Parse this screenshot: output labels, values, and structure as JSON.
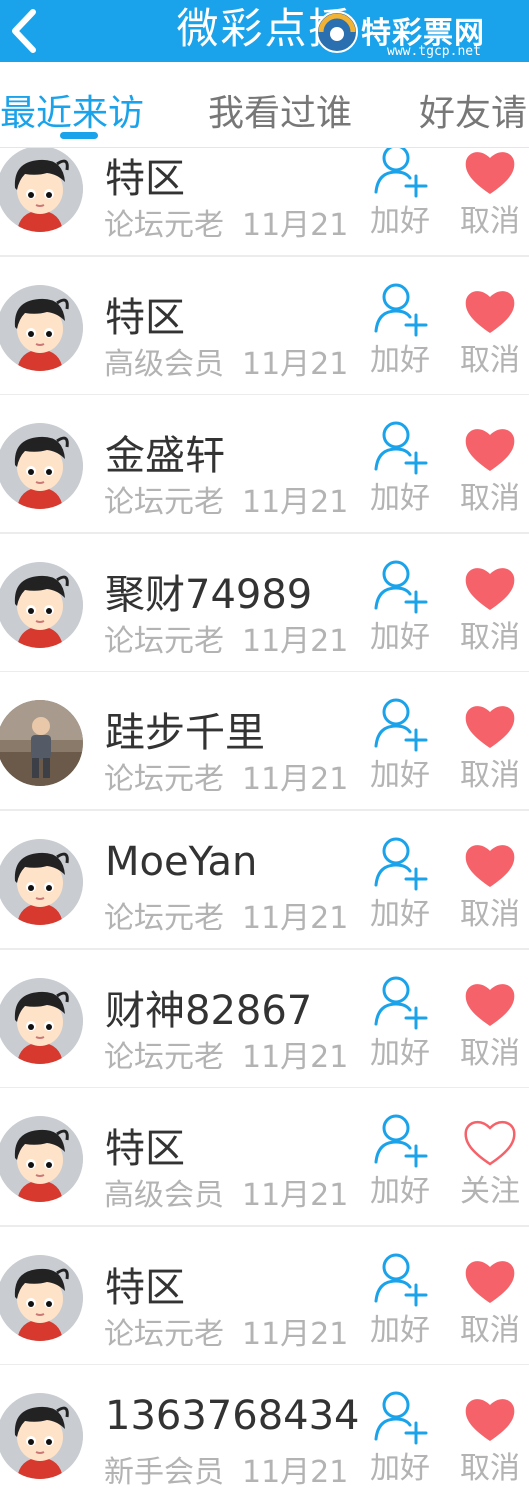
{
  "header": {
    "title": "微彩点播",
    "back_icon": "chevron-left-icon",
    "watermark": {
      "text": "特彩票网",
      "url": "www.tgcp.net"
    }
  },
  "tabs": [
    {
      "label": "最近来访",
      "active": true
    },
    {
      "label": "我看过谁",
      "active": false
    },
    {
      "label": "好友请",
      "active": false
    }
  ],
  "colors": {
    "brand": "#1aa3ea",
    "heart": "#f5626a",
    "muted": "#b3b3b3"
  },
  "users": [
    {
      "name": "特区",
      "level": "论坛元老",
      "date": "11月21",
      "add_label": "加好",
      "fav_label": "取消",
      "favorited": true,
      "avatar": "cartoon-boy"
    },
    {
      "name": "特区",
      "level": "高级会员",
      "date": "11月21",
      "add_label": "加好",
      "fav_label": "取消",
      "favorited": true,
      "avatar": "cartoon-boy"
    },
    {
      "name": "金盛轩",
      "level": "论坛元老",
      "date": "11月21",
      "add_label": "加好",
      "fav_label": "取消",
      "favorited": true,
      "avatar": "cartoon-boy"
    },
    {
      "name": "聚财74989",
      "level": "论坛元老",
      "date": "11月21",
      "add_label": "加好",
      "fav_label": "取消",
      "favorited": true,
      "avatar": "cartoon-boy"
    },
    {
      "name": "跬步千里",
      "level": "论坛元老",
      "date": "11月21",
      "add_label": "加好",
      "fav_label": "取消",
      "favorited": true,
      "avatar": "photo"
    },
    {
      "name": "MoeYan",
      "level": "论坛元老",
      "date": "11月21",
      "add_label": "加好",
      "fav_label": "取消",
      "favorited": true,
      "avatar": "cartoon-boy"
    },
    {
      "name": "财神82867",
      "level": "论坛元老",
      "date": "11月21",
      "add_label": "加好",
      "fav_label": "取消",
      "favorited": true,
      "avatar": "cartoon-boy"
    },
    {
      "name": "特区",
      "level": "高级会员",
      "date": "11月21",
      "add_label": "加好",
      "fav_label": "关注",
      "favorited": false,
      "avatar": "cartoon-boy"
    },
    {
      "name": "特区",
      "level": "论坛元老",
      "date": "11月21",
      "add_label": "加好",
      "fav_label": "取消",
      "favorited": true,
      "avatar": "cartoon-boy"
    },
    {
      "name": "1363768434",
      "level": "新手会员",
      "date": "11月21",
      "add_label": "加好",
      "fav_label": "取消",
      "favorited": true,
      "avatar": "cartoon-boy"
    }
  ]
}
